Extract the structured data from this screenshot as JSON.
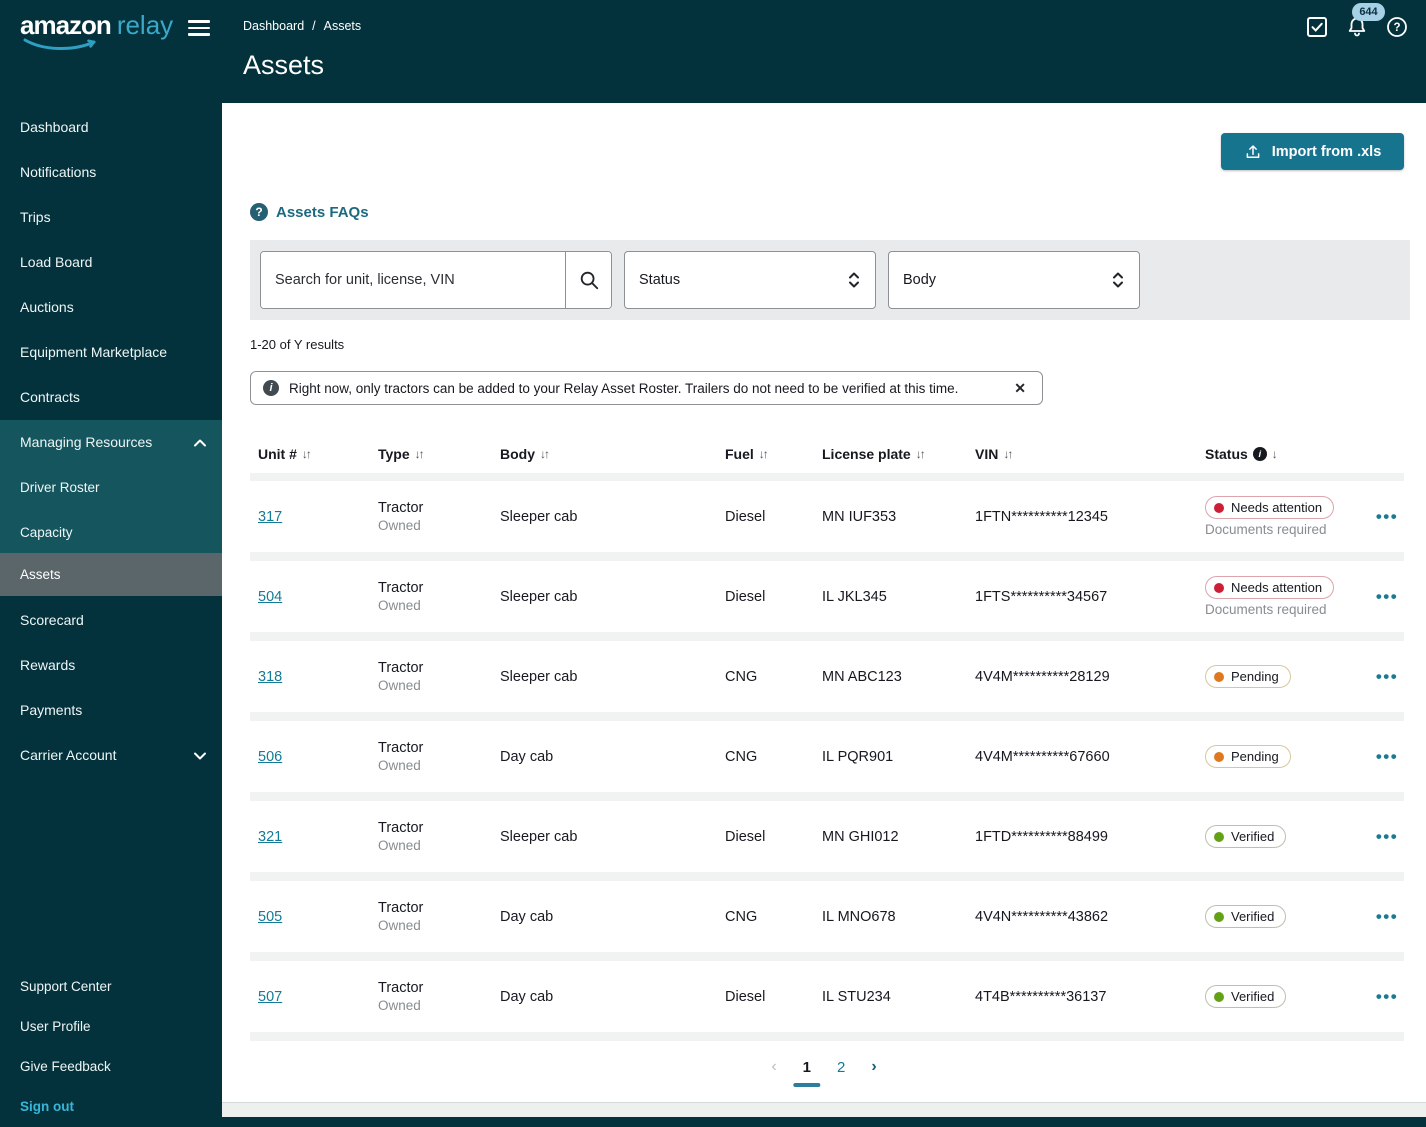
{
  "brand": {
    "name_primary": "amazon",
    "name_secondary": "relay"
  },
  "topbar": {
    "breadcrumb": {
      "items": [
        "Dashboard",
        "Assets"
      ],
      "separator": "/"
    },
    "page_title": "Assets",
    "notification_badge": "644"
  },
  "sidebar": {
    "items_top": [
      "Dashboard",
      "Notifications",
      "Trips",
      "Load Board",
      "Auctions",
      "Equipment Marketplace",
      "Contracts"
    ],
    "group": {
      "label": "Managing Resources",
      "items": [
        "Driver Roster",
        "Capacity"
      ],
      "selected": "Assets"
    },
    "items_lower": [
      "Scorecard",
      "Rewards",
      "Payments",
      "Carrier Account"
    ],
    "footer_links": [
      "Support Center",
      "User Profile",
      "Give Feedback"
    ],
    "sign_out": "Sign out"
  },
  "toolbar": {
    "import_label": "Import from .xls",
    "faq_label": "Assets FAQs"
  },
  "filters": {
    "search_placeholder": "Search for unit, license, VIN",
    "status": "Status",
    "body": "Body"
  },
  "results_summary": "1-20 of Y results",
  "banner": {
    "message": "Right now, only tractors can be added to your Relay Asset Roster. Trailers do not need to be verified at this time.",
    "close": "✕"
  },
  "table": {
    "headers": {
      "unit": "Unit #",
      "type": "Type",
      "body": "Body",
      "fuel": "Fuel",
      "license": "License plate",
      "vin": "VIN",
      "status": "Status",
      "sort_glyph": "↓↑",
      "status_sort_glyph": "↓"
    },
    "rows": [
      {
        "unit": "317",
        "type": "Tractor",
        "ownership": "Owned",
        "body": "Sleeper cab",
        "fuel": "Diesel",
        "license": "MN IUF353",
        "vin": "1FTN**********12345",
        "status": "Needs attention",
        "status_type": "attention",
        "status_note": "Documents required"
      },
      {
        "unit": "504",
        "type": "Tractor",
        "ownership": "Owned",
        "body": "Sleeper cab",
        "fuel": "Diesel",
        "license": "IL JKL345",
        "vin": "1FTS**********34567",
        "status": "Needs attention",
        "status_type": "attention",
        "status_note": "Documents required"
      },
      {
        "unit": "318",
        "type": "Tractor",
        "ownership": "Owned",
        "body": "Sleeper cab",
        "fuel": "CNG",
        "license": "MN ABC123",
        "vin": "4V4M**********28129",
        "status": "Pending",
        "status_type": "pending",
        "status_note": ""
      },
      {
        "unit": "506",
        "type": "Tractor",
        "ownership": "Owned",
        "body": "Day cab",
        "fuel": "CNG",
        "license": "IL PQR901",
        "vin": "4V4M**********67660",
        "status": "Pending",
        "status_type": "pending",
        "status_note": ""
      },
      {
        "unit": "321",
        "type": "Tractor",
        "ownership": "Owned",
        "body": "Sleeper cab",
        "fuel": "Diesel",
        "license": "MN GHI012",
        "vin": "1FTD**********88499",
        "status": "Verified",
        "status_type": "verified",
        "status_note": ""
      },
      {
        "unit": "505",
        "type": "Tractor",
        "ownership": "Owned",
        "body": "Day cab",
        "fuel": "CNG",
        "license": "IL MNO678",
        "vin": "4V4N**********43862",
        "status": "Verified",
        "status_type": "verified",
        "status_note": ""
      },
      {
        "unit": "507",
        "type": "Tractor",
        "ownership": "Owned",
        "body": "Day cab",
        "fuel": "Diesel",
        "license": "IL STU234",
        "vin": "4T4B**********36137",
        "status": "Verified",
        "status_type": "verified",
        "status_note": ""
      }
    ]
  },
  "pagination": {
    "prev": "‹",
    "pages": [
      "1",
      "2"
    ],
    "next": "›"
  },
  "colors": {
    "dark_teal": "#04323c",
    "group_teal": "#15555e",
    "selected_gray": "#5b666b",
    "accent_teal": "#16748f",
    "link_teal": "#147a96",
    "status_red": "#cc1f36",
    "status_orange": "#de7921",
    "status_green": "#64a117"
  }
}
